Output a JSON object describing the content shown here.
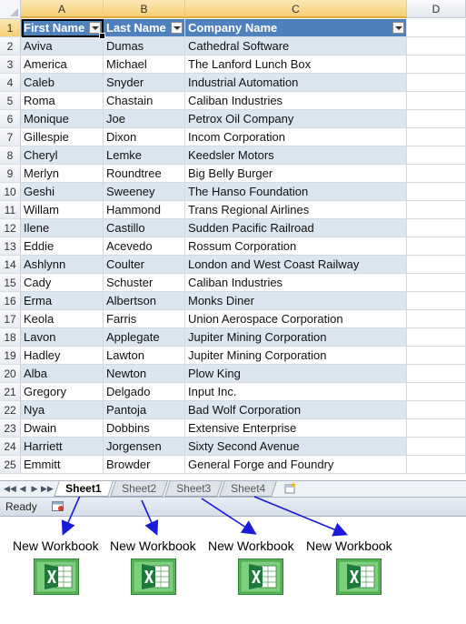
{
  "columns": [
    "A",
    "B",
    "C",
    "D"
  ],
  "table": {
    "headers": [
      "First Name",
      "Last Name",
      "Company Name"
    ],
    "rows": [
      [
        "Aviva",
        "Dumas",
        "Cathedral Software"
      ],
      [
        "America",
        "Michael",
        "The Lanford Lunch Box"
      ],
      [
        "Caleb",
        "Snyder",
        "Industrial Automation"
      ],
      [
        "Roma",
        "Chastain",
        "Caliban Industries"
      ],
      [
        "Monique",
        "Joe",
        "Petrox Oil Company"
      ],
      [
        "Gillespie",
        "Dixon",
        "Incom Corporation"
      ],
      [
        "Cheryl",
        "Lemke",
        "Keedsler Motors"
      ],
      [
        "Merlyn",
        "Roundtree",
        "Big Belly Burger"
      ],
      [
        "Geshi",
        "Sweeney",
        "The Hanso Foundation"
      ],
      [
        "Willam",
        "Hammond",
        "Trans Regional Airlines"
      ],
      [
        "Ilene",
        "Castillo",
        "Sudden Pacific Railroad"
      ],
      [
        "Eddie",
        "Acevedo",
        "Rossum Corporation"
      ],
      [
        "Ashlynn",
        "Coulter",
        "London and West Coast Railway"
      ],
      [
        "Cady",
        "Schuster",
        "Caliban Industries"
      ],
      [
        "Erma",
        "Albertson",
        "Monks Diner"
      ],
      [
        "Keola",
        "Farris",
        "Union Aerospace Corporation"
      ],
      [
        "Lavon",
        "Applegate",
        "Jupiter Mining Corporation"
      ],
      [
        "Hadley",
        "Lawton",
        "Jupiter Mining Corporation"
      ],
      [
        "Alba",
        "Newton",
        "Plow King"
      ],
      [
        "Gregory",
        "Delgado",
        "Input Inc."
      ],
      [
        "Nya",
        "Pantoja",
        "Bad Wolf Corporation"
      ],
      [
        "Dwain",
        "Dobbins",
        "Extensive Enterprise"
      ],
      [
        "Harriett",
        "Jorgensen",
        "Sixty Second Avenue"
      ],
      [
        "Emmitt",
        "Browder",
        "General Forge and Foundry"
      ]
    ]
  },
  "sheet_tabs": [
    "Sheet1",
    "Sheet2",
    "Sheet3",
    "Sheet4"
  ],
  "active_tab": "Sheet1",
  "status": "Ready",
  "workbooks": [
    "New Workbook",
    "New Workbook",
    "New Workbook",
    "New Workbook"
  ],
  "colors": {
    "header_blue": "#4f81bd",
    "band": "#dce6f1",
    "arrow": "#1a1adb",
    "excel_green": "#1e7a3c"
  },
  "icons": [
    "filter-dropdown-icon",
    "new-sheet-icon",
    "macro-record-icon",
    "excel-workbook-icon"
  ]
}
